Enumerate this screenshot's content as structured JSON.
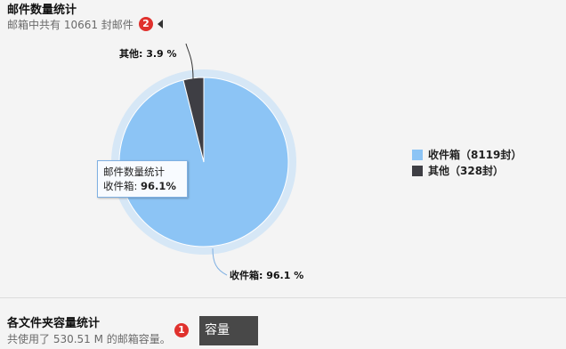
{
  "section1": {
    "title": "邮件数量统计",
    "subtitle": "邮箱中共有 10661 封邮件",
    "badge": "2"
  },
  "chart_data": {
    "type": "pie",
    "title": "",
    "categories": [
      "收件箱",
      "其他"
    ],
    "values": [
      96.1,
      3.9
    ],
    "counts": [
      8119,
      328
    ],
    "colors": [
      "#8cc4f5",
      "#3e3e44"
    ],
    "data_labels": [
      "收件箱: 96.1 %",
      "其他: 3.9 %"
    ],
    "legend": [
      "收件箱（8119封）",
      "其他（328封）"
    ],
    "legend_position": "right",
    "tooltip": {
      "title": "邮件数量统计",
      "label": "收件箱:",
      "value": "96.1%"
    }
  },
  "section2": {
    "title": "各文件夹容量统计",
    "subtitle": "共使用了 530.51 M 的邮箱容量。",
    "badge": "1",
    "capacity_label": "容量"
  }
}
